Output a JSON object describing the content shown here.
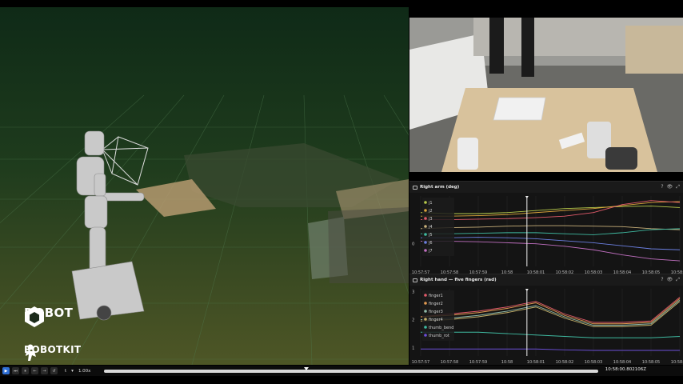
{
  "brands": {
    "dobot": "DOBOT",
    "robotkit": "ROBOTKIT"
  },
  "panels": {
    "arm": {
      "title": "Right arm (deg)",
      "help": "?",
      "eye": "👁",
      "expand": "⤢"
    },
    "hand": {
      "title": "Right hand — five fingers (rad)",
      "help": "?",
      "eye": "👁",
      "expand": "⤢"
    }
  },
  "timeline": {
    "speed": "1.00x",
    "mode": "t",
    "time": "10:58:00.802106Z",
    "cursor_fraction": 0.41
  },
  "time_ticks": [
    "10:57:57",
    "10:57:58",
    "10:57:59",
    "10:58",
    "10:58:01",
    "10:58:02",
    "10:58:03",
    "10:58:04",
    "10:58:05",
    "10:58:06"
  ],
  "arm_y_ticks": [
    "0"
  ],
  "hand_y_ticks": [
    "3",
    "2",
    "1"
  ],
  "arm_legend": [
    {
      "label": "j1",
      "color": "#b5c84a"
    },
    {
      "label": "j2",
      "color": "#d9a43b"
    },
    {
      "label": "j3",
      "color": "#e05a6a"
    },
    {
      "label": "j4",
      "color": "#c9b07a"
    },
    {
      "label": "j5",
      "color": "#3fb9a0"
    },
    {
      "label": "j6",
      "color": "#6b7fe0"
    },
    {
      "label": "j7",
      "color": "#c06fc0"
    }
  ],
  "hand_legend": [
    {
      "label": "finger1",
      "color": "#e05a6a"
    },
    {
      "label": "finger2",
      "color": "#e29a52"
    },
    {
      "label": "finger3",
      "color": "#8fb8a8"
    },
    {
      "label": "finger4",
      "color": "#c7b26a"
    },
    {
      "label": "thumb_bend",
      "color": "#3fb9a0"
    },
    {
      "label": "thumb_rot",
      "color": "#6b4fd8"
    }
  ],
  "chart_data": [
    {
      "type": "line",
      "title": "Right arm (deg)",
      "x": [
        "10:57:57",
        "10:57:58",
        "10:57:59",
        "10:58",
        "10:58:01",
        "10:58:02",
        "10:58:03",
        "10:58:04",
        "10:58:05",
        "10:58:06"
      ],
      "series": [
        {
          "name": "j1",
          "values": [
            0.62,
            0.6,
            0.6,
            0.62,
            0.66,
            0.7,
            0.72,
            0.74,
            0.75,
            0.72
          ]
        },
        {
          "name": "j2",
          "values": [
            0.55,
            0.55,
            0.56,
            0.58,
            0.62,
            0.66,
            0.7,
            0.76,
            0.82,
            0.84
          ]
        },
        {
          "name": "j3",
          "values": [
            0.48,
            0.48,
            0.49,
            0.5,
            0.52,
            0.55,
            0.62,
            0.78,
            0.86,
            0.82
          ]
        },
        {
          "name": "j4",
          "values": [
            0.3,
            0.32,
            0.33,
            0.35,
            0.36,
            0.36,
            0.35,
            0.34,
            0.3,
            0.28
          ]
        },
        {
          "name": "j5",
          "values": [
            0.2,
            0.2,
            0.21,
            0.22,
            0.22,
            0.2,
            0.18,
            0.22,
            0.28,
            0.3
          ]
        },
        {
          "name": "j6",
          "values": [
            0.12,
            0.12,
            0.13,
            0.12,
            0.1,
            0.06,
            0.02,
            -0.04,
            -0.1,
            -0.12
          ]
        },
        {
          "name": "j7",
          "values": [
            0.05,
            0.05,
            0.04,
            0.02,
            0.0,
            -0.05,
            -0.12,
            -0.22,
            -0.3,
            -0.34
          ]
        }
      ]
    },
    {
      "type": "line",
      "title": "Right hand — five fingers (rad)",
      "x": [
        "10:57:57",
        "10:57:58",
        "10:57:59",
        "10:58",
        "10:58:01",
        "10:58:02",
        "10:58:03",
        "10:58:04",
        "10:58:05",
        "10:58:06"
      ],
      "ylim": [
        0.5,
        3.1
      ],
      "series": [
        {
          "name": "finger1",
          "values": [
            2.1,
            2.2,
            2.3,
            2.45,
            2.65,
            2.2,
            1.9,
            1.9,
            1.95,
            2.8
          ]
        },
        {
          "name": "finger2",
          "values": [
            2.1,
            2.15,
            2.25,
            2.4,
            2.6,
            2.15,
            1.85,
            1.85,
            1.9,
            2.75
          ]
        },
        {
          "name": "finger3",
          "values": [
            2.0,
            2.05,
            2.15,
            2.3,
            2.5,
            2.1,
            1.8,
            1.8,
            1.85,
            2.7
          ]
        },
        {
          "name": "finger4",
          "values": [
            1.95,
            2.0,
            2.1,
            2.25,
            2.45,
            2.05,
            1.75,
            1.75,
            1.8,
            2.65
          ]
        },
        {
          "name": "thumb_bend",
          "values": [
            1.55,
            1.55,
            1.55,
            1.5,
            1.45,
            1.4,
            1.35,
            1.35,
            1.35,
            1.4
          ]
        },
        {
          "name": "thumb_rot",
          "values": [
            0.95,
            0.95,
            0.95,
            0.95,
            0.95,
            0.92,
            0.9,
            0.9,
            0.9,
            0.9
          ]
        }
      ]
    }
  ]
}
